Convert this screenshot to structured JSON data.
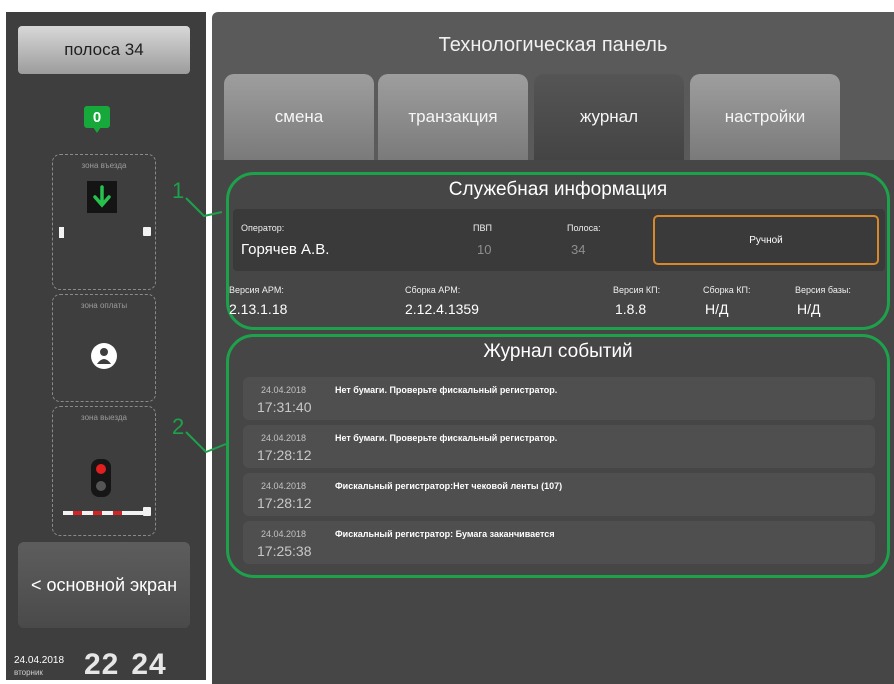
{
  "sidebar": {
    "lane_button": "полоса 34",
    "marker_digit": "0",
    "zones": {
      "exit_top": "зона въезда",
      "payment": "зона оплаты",
      "exit_bottom": "зона выезда"
    },
    "back_button": "< основной экран",
    "date": "24.04.2018",
    "weekday": "вторник",
    "time_hours": "22",
    "time_minutes": "24"
  },
  "main": {
    "title": "Технологическая панель",
    "tabs": [
      {
        "label": "смена"
      },
      {
        "label": "транзакция"
      },
      {
        "label": "журнал"
      },
      {
        "label": "настройки"
      }
    ],
    "active_tab": "журнал"
  },
  "service_info": {
    "title": "Служебная информация",
    "operator_label": "Оператор:",
    "operator_value": "Горячев А.В.",
    "pvp_label": "ПВП",
    "pvp_value": "10",
    "lane_label": "Полоса:",
    "lane_value": "34",
    "mode_value": "Ручной",
    "arm_version_label": "Версия АРМ:",
    "arm_version_value": "2.13.1.18",
    "arm_build_label": "Сборка АРМ:",
    "arm_build_value": "2.12.4.1359",
    "kp_version_label": "Версия КП:",
    "kp_version_value": "1.8.8",
    "kp_build_label": "Сборка КП:",
    "kp_build_value": "Н/Д",
    "db_version_label": "Версия базы:",
    "db_version_value": "Н/Д"
  },
  "event_log": {
    "title": "Журнал событий",
    "events": [
      {
        "date": "24.04.2018",
        "time": "17:31:40",
        "text": "Нет бумаги. Проверьте фискальный регистратор."
      },
      {
        "date": "24.04.2018",
        "time": "17:28:12",
        "text": "Нет бумаги. Проверьте фискальный регистратор."
      },
      {
        "date": "24.04.2018",
        "time": "17:28:12",
        "text": "Фискальный регистратор:Нет чековой ленты (107)"
      },
      {
        "date": "24.04.2018",
        "time": "17:25:38",
        "text": "Фискальный регистратор: Бумага заканчивается"
      }
    ]
  },
  "callouts": {
    "one": "1",
    "two": "2"
  },
  "colors": {
    "accent_green": "#1da14a",
    "mode_orange": "#d8882a",
    "signal_red": "#e21f1f"
  }
}
